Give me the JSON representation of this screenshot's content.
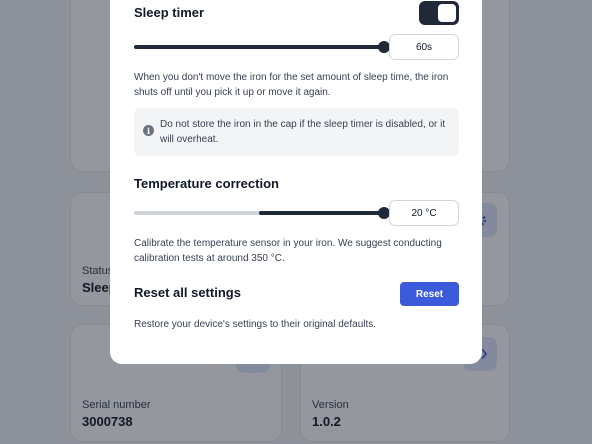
{
  "colors": {
    "accent": "#3b5bdb",
    "slider_fill": "#1f2937",
    "overlay": "#111827"
  },
  "background": {
    "status": {
      "label": "Status",
      "value": "Sleep"
    },
    "serial": {
      "label": "Serial number",
      "value": "3000738"
    },
    "version": {
      "label": "Version",
      "value": "1.0.2"
    },
    "icons": [
      "gear-icon",
      "code-icon"
    ]
  },
  "modal": {
    "sleep_timer": {
      "title": "Sleep timer",
      "enabled": true,
      "slider_level": 1.0,
      "value": "60s",
      "description": "When you don't move the iron for the set amount of sleep time, the iron shuts off until you pick it up or move it again.",
      "notice": "Do not store the iron in the cap if the sleep timer is disabled, or it will overheat."
    },
    "temperature_correction": {
      "title": "Temperature correction",
      "slider_center": 0.5,
      "slider_level": 1.0,
      "value": "20 °C",
      "description": "Calibrate the temperature sensor in your iron. We suggest conducting calibration tests at around 350 °C."
    },
    "reset": {
      "title": "Reset all settings",
      "button_label": "Reset",
      "description": "Restore your device's settings to their original defaults."
    }
  }
}
